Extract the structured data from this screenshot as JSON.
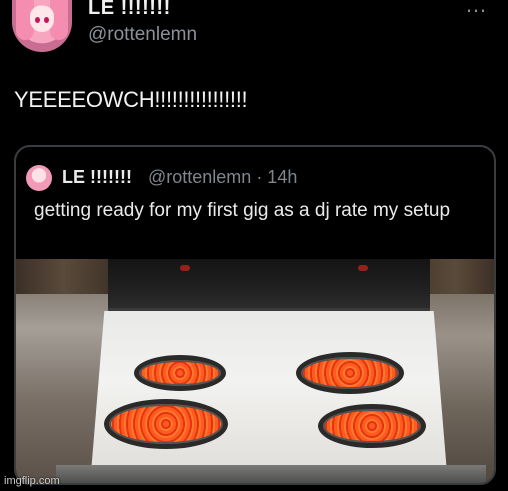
{
  "tweet": {
    "display_name": "LE !!!!!!!",
    "handle": "@rottenlemn",
    "more_icon": "…",
    "text": "YEEEEOWCH!!!!!!!!!!!!!!!!"
  },
  "quoted_tweet": {
    "display_name": "LE !!!!!!!",
    "handle_time": "@rottenlemn · 14h",
    "text": "getting ready for my first gig as a dj rate my setup",
    "image": "stove-with-glowing-burners"
  },
  "watermark": "imgflip.com",
  "colors": {
    "background": "#000000",
    "text_primary": "#e7e9ea",
    "text_secondary": "#8b9197",
    "card_border": "#3a3d40",
    "burner_glow": "#ff5a1f"
  }
}
